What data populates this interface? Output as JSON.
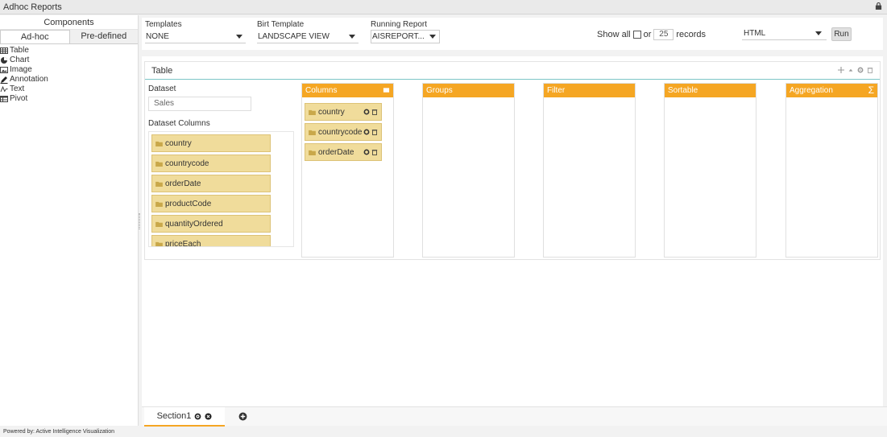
{
  "app": {
    "title": "Adhoc Reports",
    "footer": "Powered by: Active Intelligence Visualization"
  },
  "left_panel": {
    "header": "Components",
    "tabs": [
      {
        "label": "Ad-hoc"
      },
      {
        "label": "Pre-defined"
      }
    ],
    "items": [
      {
        "label": "Table",
        "icon": "table-icon"
      },
      {
        "label": "Chart",
        "icon": "pie-chart-icon"
      },
      {
        "label": "Image",
        "icon": "image-icon"
      },
      {
        "label": "Annotation",
        "icon": "pencil-icon"
      },
      {
        "label": "Text",
        "icon": "text-icon"
      },
      {
        "label": "Pivot",
        "icon": "pivot-icon"
      }
    ]
  },
  "toolbar": {
    "templates": {
      "label": "Templates",
      "value": "NONE"
    },
    "birt_template": {
      "label": "Birt Template",
      "value": "LANDSCAPE VIEW"
    },
    "running_report": {
      "label": "Running Report",
      "value": "AISREPORT..."
    },
    "show_all": {
      "prefix": "Show all",
      "or": "or",
      "count": "25",
      "suffix": "records"
    },
    "format": {
      "value": "HTML"
    },
    "run_label": "Run"
  },
  "table_component": {
    "title": "Table",
    "dataset_label": "Dataset",
    "dataset_value": "Sales",
    "dataset_columns_label": "Dataset Columns",
    "dataset_columns": [
      "country",
      "countrycode",
      "orderDate",
      "productCode",
      "quantityOrdered",
      "priceEach"
    ],
    "drop_zones": [
      {
        "label": "Columns",
        "items": [
          "country",
          "countrycode",
          "orderDate"
        ]
      },
      {
        "label": "Groups",
        "items": []
      },
      {
        "label": "Filter",
        "items": []
      },
      {
        "label": "Sortable",
        "items": []
      },
      {
        "label": "Aggregation",
        "items": [],
        "symbol": "Σ"
      }
    ]
  },
  "sections": [
    {
      "label": "Section1"
    }
  ],
  "colors": {
    "accent": "#f5a623",
    "chip": "#f0dc9b",
    "teal_line": "#7cc5c7"
  }
}
